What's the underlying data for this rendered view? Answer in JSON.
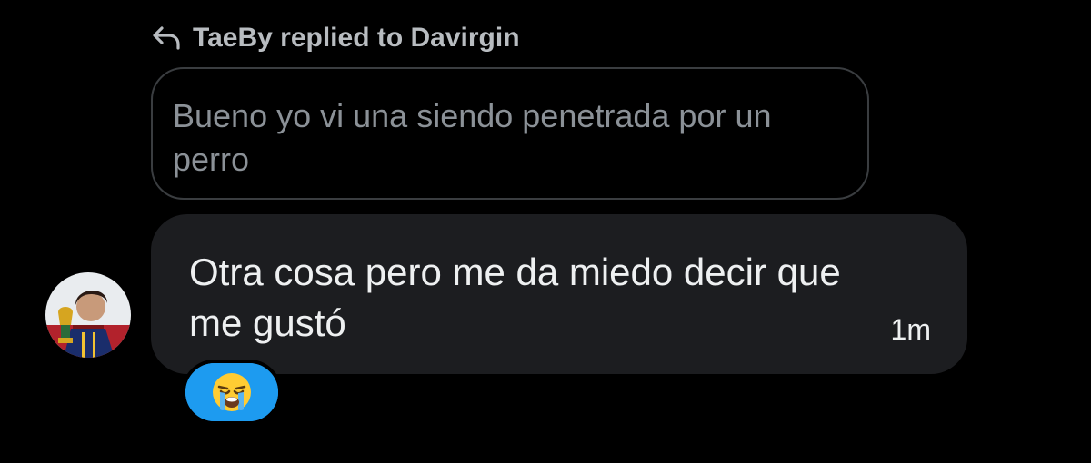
{
  "reply_header": {
    "icon": "reply-arrow-icon",
    "text": "TaeBy replied to Davirgin"
  },
  "quoted_message": {
    "text": "Bueno yo vi una siendo penetrada por un perro"
  },
  "message": {
    "text": "Otra cosa pero me da miedo decir que me gustó",
    "timestamp": "1m",
    "avatar_icon": "user-avatar"
  },
  "reaction": {
    "emoji": "loudly-crying-face-icon"
  },
  "colors": {
    "background": "#000000",
    "bubble": "#1c1d20",
    "quoted_border": "#3a3d40",
    "quoted_text": "#8b9197",
    "reaction_bg": "#1d9bf0"
  }
}
